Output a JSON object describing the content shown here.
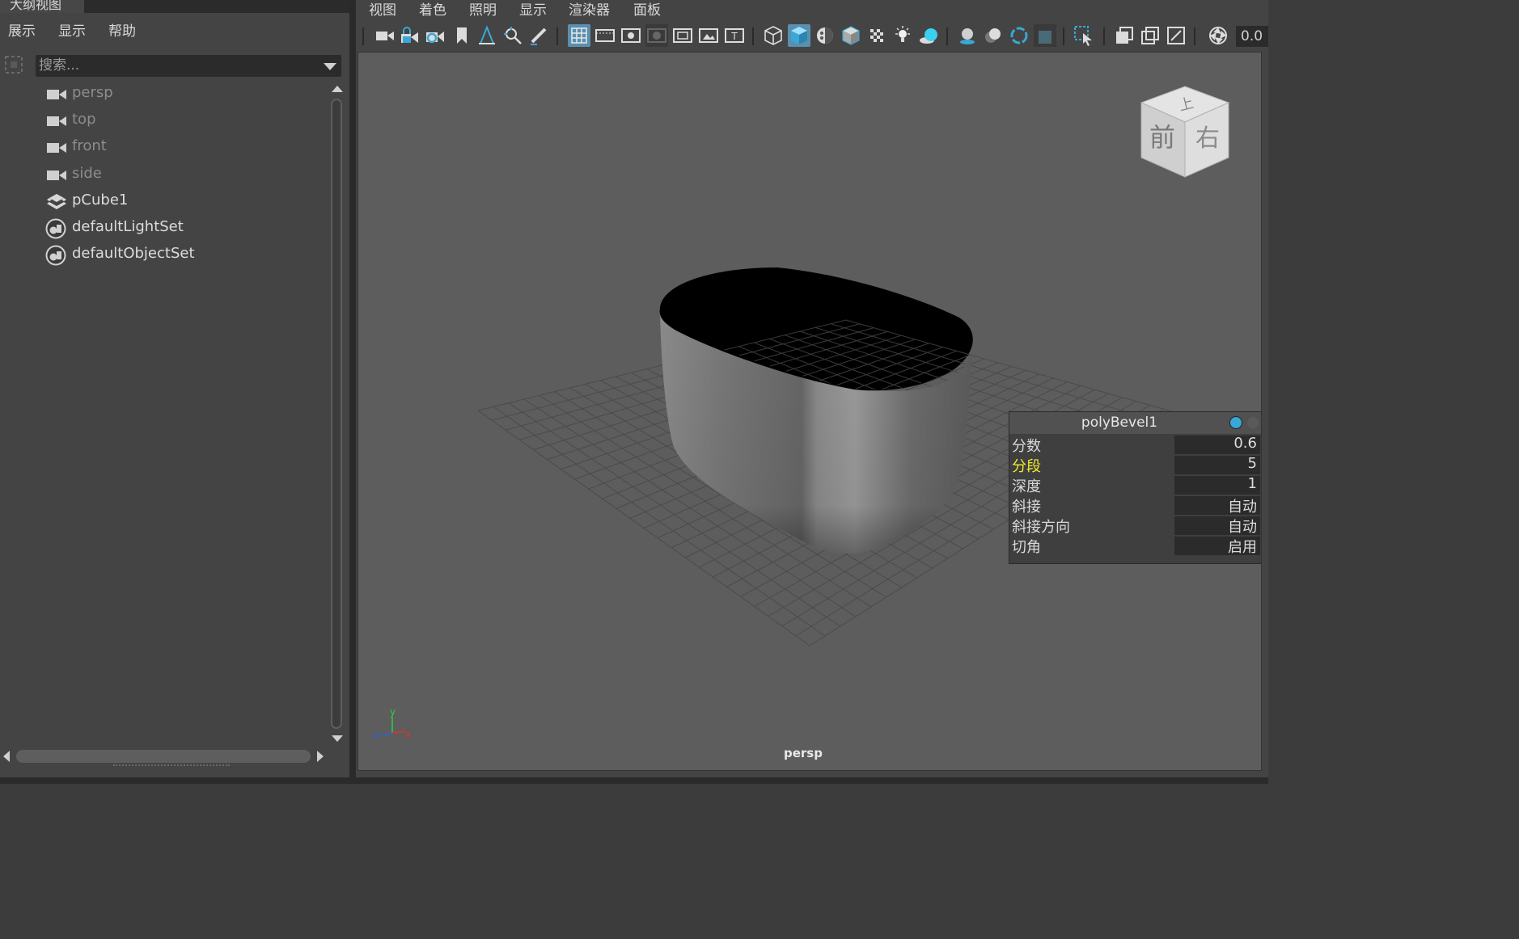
{
  "outliner": {
    "tab_title": "大纲视图",
    "menu": [
      "展示",
      "显示",
      "帮助"
    ],
    "search_placeholder": "搜索...",
    "items": [
      {
        "label": "persp",
        "icon": "camera-icon",
        "dim": true
      },
      {
        "label": "top",
        "icon": "camera-icon",
        "dim": true
      },
      {
        "label": "front",
        "icon": "camera-icon",
        "dim": true
      },
      {
        "label": "side",
        "icon": "camera-icon",
        "dim": true
      },
      {
        "label": "pCube1",
        "icon": "mesh-icon",
        "dim": false
      },
      {
        "label": "defaultLightSet",
        "icon": "set-icon",
        "dim": false
      },
      {
        "label": "defaultObjectSet",
        "icon": "set-icon",
        "dim": false
      }
    ]
  },
  "panel": {
    "menu": [
      "视图",
      "着色",
      "照明",
      "显示",
      "渲染器",
      "面板"
    ],
    "toolbar_field_value": "0.0",
    "camera_name": "persp",
    "view_cube": {
      "top": "上",
      "front": "前",
      "right": "右"
    },
    "axis": {
      "x": "x",
      "y": "y",
      "z": "z"
    },
    "colors": {
      "accent": "#3aa7d6",
      "highlight_attr": "#f0ea2c",
      "viewport_bg": "#5d5d5d"
    }
  },
  "inview_editor": {
    "title": "polyBevel1",
    "attributes": [
      {
        "name": "分数",
        "value": "0.6",
        "highlight": false
      },
      {
        "name": "分段",
        "value": "5",
        "highlight": true
      },
      {
        "name": "深度",
        "value": "1",
        "highlight": false
      },
      {
        "name": "斜接",
        "value": "自动",
        "highlight": false
      },
      {
        "name": "斜接方向",
        "value": "自动",
        "highlight": false
      },
      {
        "name": "切角",
        "value": "启用",
        "highlight": false
      }
    ]
  }
}
